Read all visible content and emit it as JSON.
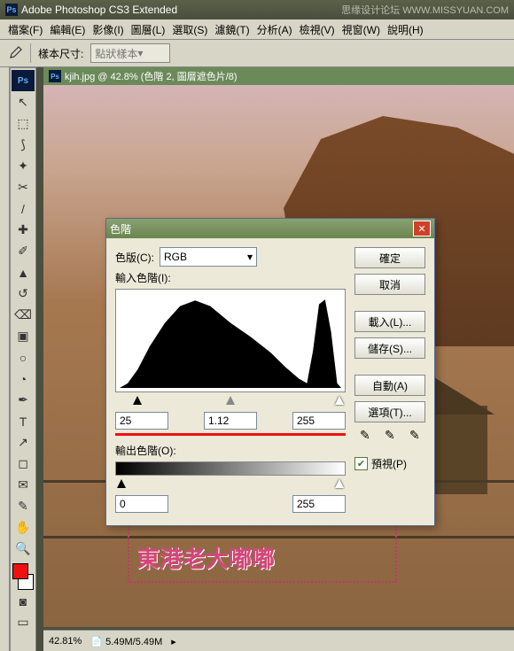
{
  "app_title": "Adobe Photoshop CS3 Extended",
  "watermark_right": "思缘设计论坛  WWW.MISSYUAN.COM",
  "menu": [
    "檔案(F)",
    "編輯(E)",
    "影像(I)",
    "圖層(L)",
    "選取(S)",
    "濾鏡(T)",
    "分析(A)",
    "檢視(V)",
    "視窗(W)",
    "說明(H)"
  ],
  "optionbar": {
    "label": "樣本尺寸:",
    "value": "點狀樣本"
  },
  "document": {
    "title": "kjih.jpg @ 42.8% (色階 2, 圖層遮色片/8)"
  },
  "status": {
    "zoom": "42.81%",
    "docinfo": "5.49M/5.49M"
  },
  "pink_watermark": "東港老大嘟嘟",
  "dialog": {
    "title": "色階",
    "channel_label": "色版(C):",
    "channel_value": "RGB",
    "input_label": "輸入色階(I):",
    "in_black": "25",
    "in_gamma": "1.12",
    "in_white": "255",
    "output_label": "輸出色階(O):",
    "out_black": "0",
    "out_white": "255",
    "buttons": {
      "ok": "確定",
      "cancel": "取消",
      "load": "載入(L)...",
      "save": "儲存(S)...",
      "auto": "自動(A)",
      "options": "選項(T)..."
    },
    "preview": "預視(P)"
  },
  "tool_icons": [
    "▯",
    "↖",
    "⬚",
    "✎",
    "⌕",
    "✂",
    "/",
    "✐",
    "⌫",
    "●",
    "▣",
    "◔",
    "⎚",
    "◐",
    "T",
    "↗",
    "◻",
    "⬯",
    "✋",
    "🔍"
  ]
}
